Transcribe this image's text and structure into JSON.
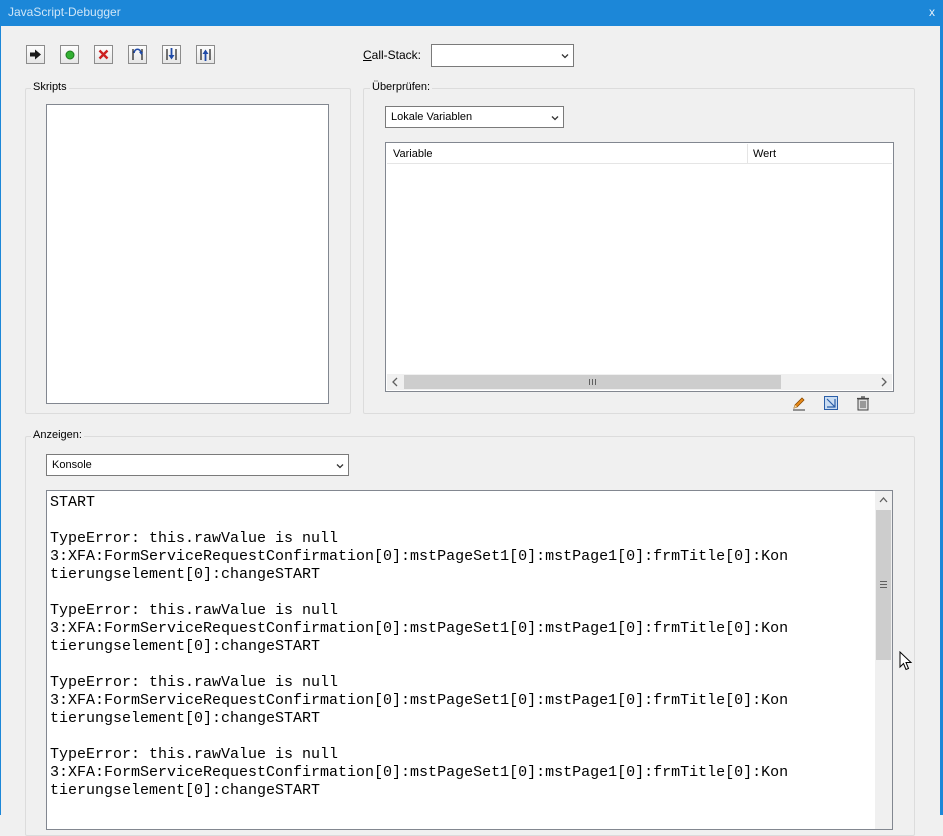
{
  "window": {
    "title": "JavaScript-Debugger",
    "close_glyph": "x"
  },
  "toolbar": {
    "buttons": [
      {
        "name": "resume-icon",
        "color": "#1a1a1a"
      },
      {
        "name": "stop-green-icon",
        "color": "#2aa02a"
      },
      {
        "name": "cancel-icon",
        "color": "#cc2020"
      },
      {
        "name": "step-over-icon",
        "color": "#1f4aa8"
      },
      {
        "name": "step-into-icon",
        "color": "#1f4aa8"
      },
      {
        "name": "step-out-icon",
        "color": "#1f4aa8"
      }
    ],
    "callstack_label_accel": "C",
    "callstack_label_rest": "all-Stack:",
    "callstack_value": ""
  },
  "scripts_panel": {
    "label": "Skripts"
  },
  "inspect_panel": {
    "label": "Überprüfen:",
    "scope_select": "Lokale Variablen",
    "columns": [
      "Variable",
      "Wert"
    ],
    "rows": [],
    "icons": [
      "edit-icon",
      "new-watch-icon",
      "delete-icon"
    ]
  },
  "display_panel": {
    "label": "Anzeigen:",
    "view_select": "Konsole",
    "console_text": "START\n\nTypeError: this.rawValue is null\n3:XFA:FormServiceRequestConfirmation[0]:mstPageSet1[0]:mstPage1[0]:frmTitle[0]:Kon\ntierungselement[0]:changeSTART\n\nTypeError: this.rawValue is null\n3:XFA:FormServiceRequestConfirmation[0]:mstPageSet1[0]:mstPage1[0]:frmTitle[0]:Kon\ntierungselement[0]:changeSTART\n\nTypeError: this.rawValue is null\n3:XFA:FormServiceRequestConfirmation[0]:mstPageSet1[0]:mstPage1[0]:frmTitle[0]:Kon\ntierungselement[0]:changeSTART\n\nTypeError: this.rawValue is null\n3:XFA:FormServiceRequestConfirmation[0]:mstPageSet1[0]:mstPage1[0]:frmTitle[0]:Kon\ntierungselement[0]:changeSTART"
  }
}
